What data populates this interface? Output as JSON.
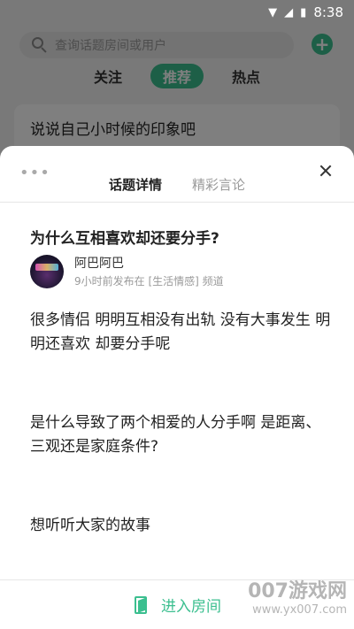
{
  "status_bar": {
    "time": "8:38",
    "wifi_icon": "wifi-icon",
    "signal_icon": "signal-icon",
    "battery_icon": "battery-icon"
  },
  "search": {
    "placeholder": "查询话题房间或用户"
  },
  "feed_tabs": [
    {
      "label": "关注",
      "active": false
    },
    {
      "label": "推荐",
      "active": true
    },
    {
      "label": "热点",
      "active": false
    }
  ],
  "background_card": {
    "title": "说说自己小时候的印象吧"
  },
  "sheet": {
    "tabs": [
      {
        "label": "话题详情",
        "active": true
      },
      {
        "label": "精彩言论",
        "active": false
      }
    ],
    "title": "为什么互相喜欢却还要分手?",
    "author": {
      "name": "阿巴阿巴",
      "meta": "9小时前发布在 [生活情感] 频道"
    },
    "paragraphs": [
      "很多情侣 明明互相没有出轨 没有大事发生 明明还喜欢 却要分手呢",
      "是什么导致了两个相爱的人分手啊 是距离、三观还是家庭条件?",
      "想听听大家的故事"
    ],
    "enter_label": "进入房间"
  },
  "watermark": {
    "main": "007游戏网",
    "url": "www.yx007.com"
  },
  "colors": {
    "accent": "#3bbf8f"
  }
}
